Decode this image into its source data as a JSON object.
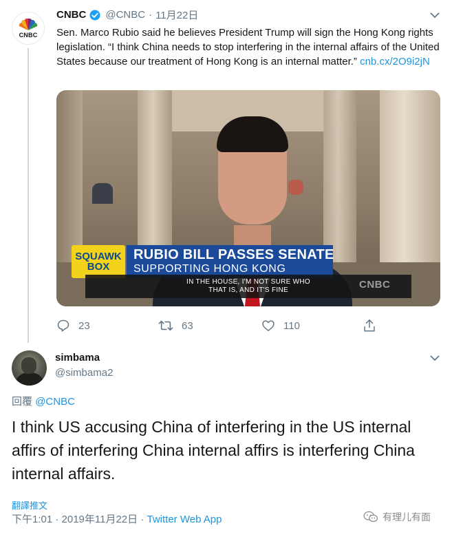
{
  "parent_tweet": {
    "display_name": "CNBC",
    "handle": "@CNBC",
    "separator": "·",
    "time": "11月22日",
    "text": "Sen. Marco Rubio said he believes President Trump will sign the Hong Kong rights legislation. “I think China needs to stop interfering in the internal affairs of the United States because our treatment of Hong Kong is an internal matter.”",
    "link": "cnb.cx/2O9i2jN",
    "avatar_logo_text": "CNBC",
    "video": {
      "show_badge": "SQUAWK",
      "show_badge_line2": "BOX",
      "headline": "RUBIO BILL PASSES SENATE",
      "subheadline": "SUPPORTING HONG KONG",
      "caption": "IN THE HOUSE, I'M NOT SURE WHO\nTHAT IS, AND IT'S FINE",
      "network_bug": "CNBC"
    },
    "actions": {
      "reply_count": "23",
      "retweet_count": "63",
      "like_count": "110"
    }
  },
  "reply_tweet": {
    "display_name": "simbama",
    "handle": "@simbama2",
    "reply_prefix": "回覆",
    "reply_to": "@CNBC",
    "text": "I think US accusing China of interfering in the US internal affirs of interfering China internal affirs is interfering China internal affairs.",
    "translate_label": "翻譯推文",
    "timestamp": "下午1:01 · 2019年11月22日 ·",
    "source": "Twitter Web App"
  },
  "watermark": {
    "text": "有理儿有面"
  },
  "colors": {
    "link": "#1b95e0",
    "muted": "#657786",
    "text": "#14171a",
    "verified": "#1da1f2",
    "squawk_yellow": "#f2d21b",
    "headline_blue": "#1b4a9b"
  },
  "icons": {
    "verified": "verified-badge-icon",
    "caret": "chevron-down-icon",
    "reply": "reply-icon",
    "retweet": "retweet-icon",
    "like": "heart-icon",
    "share": "share-icon",
    "watermark": "wechat-icon"
  }
}
